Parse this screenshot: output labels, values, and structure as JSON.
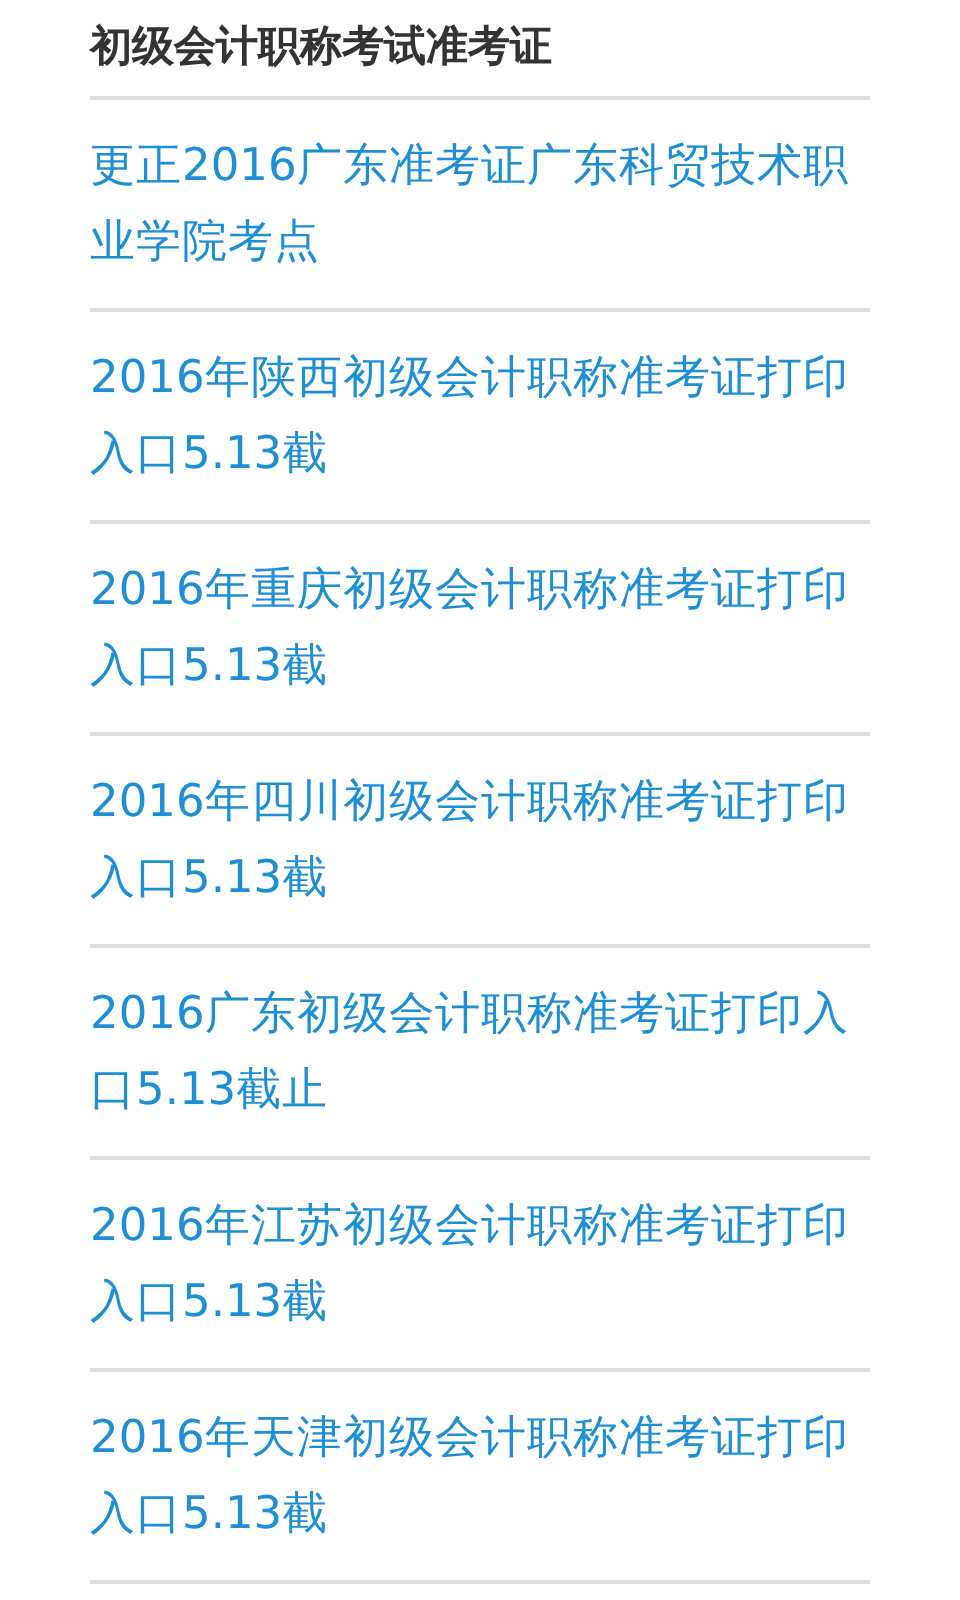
{
  "title": "初级会计职称考试准考证",
  "links": [
    {
      "text": "更正2016广东准考证广东科贸技术职业学院考点"
    },
    {
      "text": "2016年陕西初级会计职称准考证打印入口5.13截"
    },
    {
      "text": "2016年重庆初级会计职称准考证打印入口5.13截"
    },
    {
      "text": "2016年四川初级会计职称准考证打印入口5.13截"
    },
    {
      "text": "2016广东初级会计职称准考证打印入口5.13截止"
    },
    {
      "text": "2016年江苏初级会计职称准考证打印入口5.13截"
    },
    {
      "text": "2016年天津初级会计职称准考证打印入口5.13截"
    }
  ]
}
